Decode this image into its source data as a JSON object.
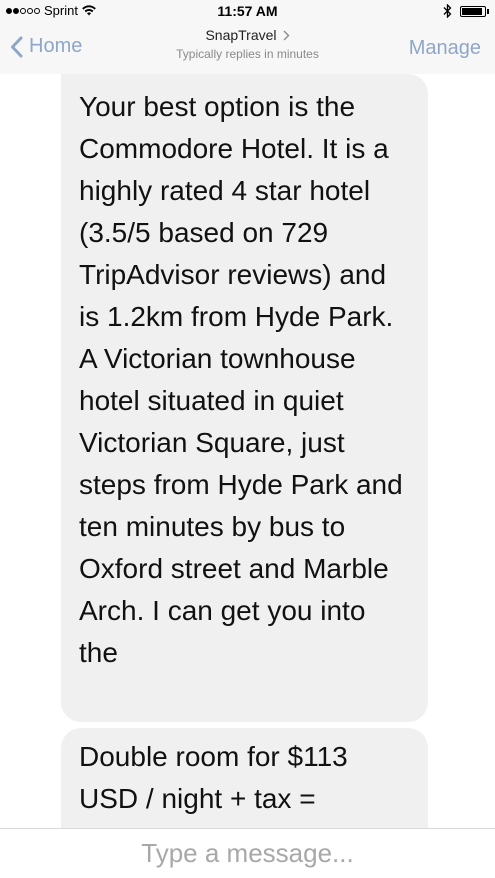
{
  "status_bar": {
    "carrier": "Sprint",
    "signal_bars": 2,
    "signal_total": 5,
    "time": "11:57 AM",
    "battery_level": 0.92
  },
  "nav": {
    "back_label": "Home",
    "title": "SnapTravel",
    "subtitle": "Typically replies in minutes",
    "manage_label": "Manage",
    "accent_color": "#8ea7c9"
  },
  "messages": [
    {
      "sender": "bot",
      "text": "Your best option is the Commodore Hotel. It is a highly rated 4 star hotel (3.5/5 based on 729 TripAdvisor reviews) and is 1.2km from Hyde Park. A Victorian townhouse hotel situated in quiet Victorian Square, just steps from Hyde Park and ten minutes by bus to Oxford street and Marble Arch. I can get you into the"
    },
    {
      "sender": "bot",
      "text": "Double room for $113 USD / night + tax ="
    }
  ],
  "composer": {
    "placeholder": "Type a message..."
  }
}
